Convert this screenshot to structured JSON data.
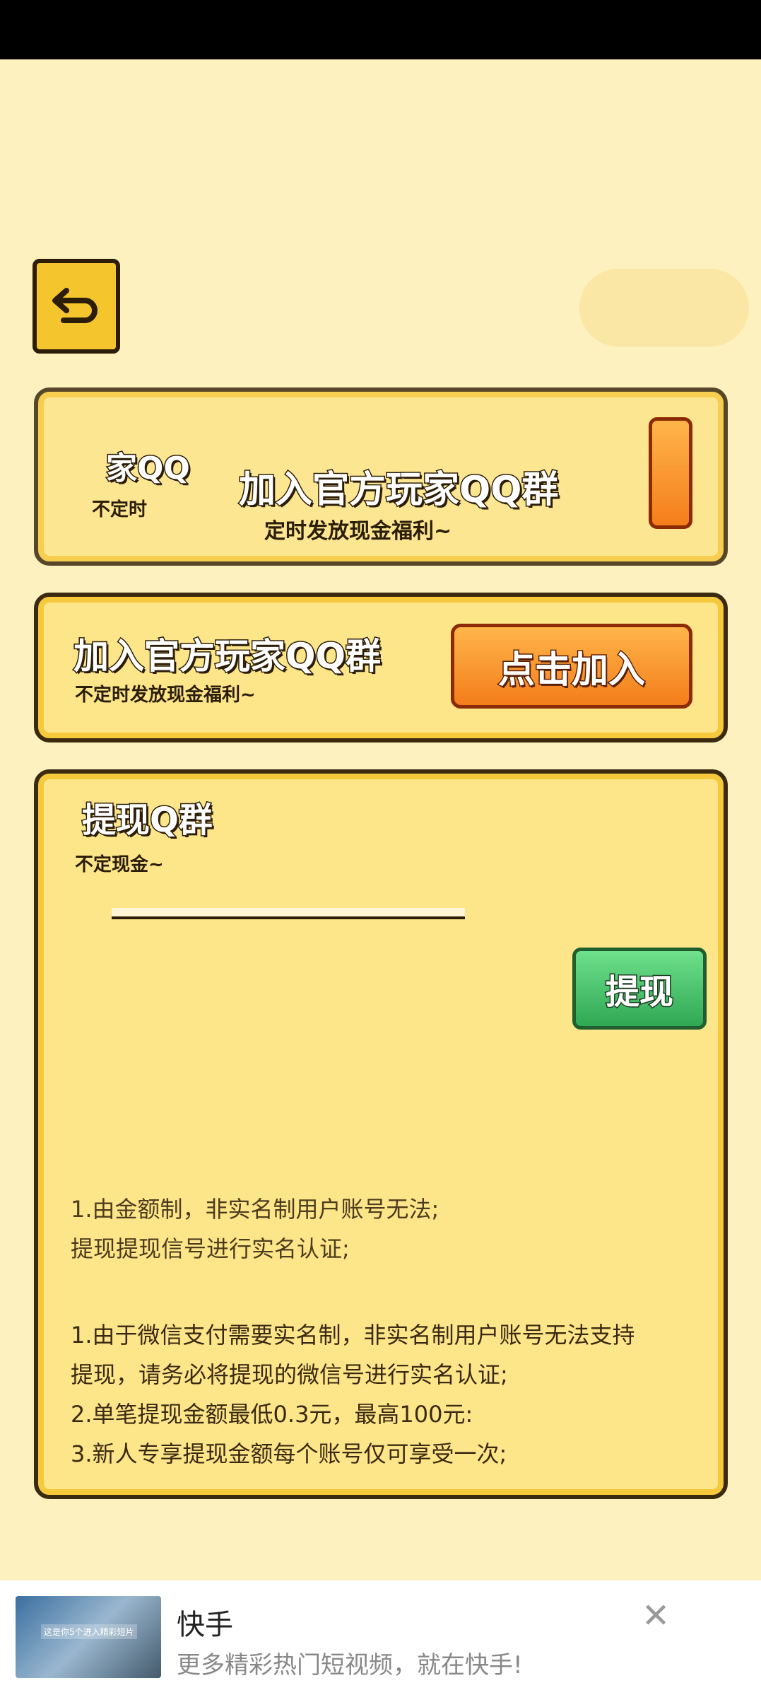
{
  "colors": {
    "background": "#fdf1bf",
    "panel": "#fde58a",
    "panel_border": "#3a2a10",
    "join_button": "#f47d1b",
    "withdraw_button": "#2fa854"
  },
  "back_button": {
    "icon": "undo-arrow-icon"
  },
  "qq_card_ghost": {
    "title": "加入官方玩家QQ群",
    "subtitle": "定时发放现金福利~",
    "fragment_left": "家QQ",
    "fragment_sub": "不定时"
  },
  "qq_card": {
    "title": "加入官方玩家QQ群",
    "subtitle": "不定时发放现金福利~",
    "join_label": "点击加入"
  },
  "withdraw_card": {
    "title": "提现Q群",
    "subtitle": "不定现金~",
    "withdraw_label": "提现",
    "rules_ghost": [
      "1.由金额制，非实名制用户账号无法;",
      "提现提现信号进行实名认证;"
    ],
    "rules": [
      "1.由于微信支付需要实名制，非实名制用户账号无法支持",
      "提现，请务必将提现的微信号进行实名认证;",
      "2.单笔提现金额最低0.3元，最高100元:",
      "3.新人专享提现金额每个账号仅可享受一次;"
    ]
  },
  "ad": {
    "thumb_text": "这是你5个进入精彩短片",
    "title": "快手",
    "description": "更多精彩热门短视频，就在快手!",
    "close_icon": "close-icon"
  }
}
